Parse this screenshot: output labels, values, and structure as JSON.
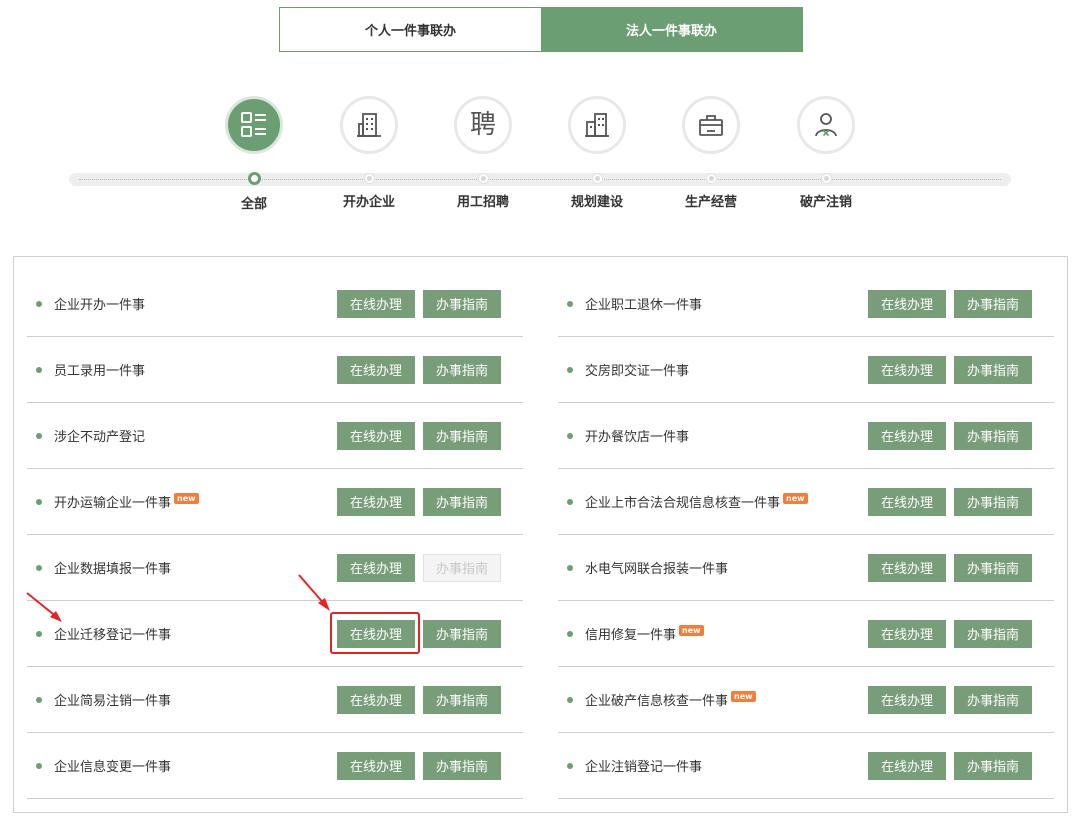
{
  "tabs": [
    {
      "label": "个人一件事联办",
      "active": false
    },
    {
      "label": "法人一件事联办",
      "active": true
    }
  ],
  "categories": [
    {
      "label": "全部",
      "icon": "grid-list-icon",
      "active": true
    },
    {
      "label": "开办企业",
      "icon": "building-icon",
      "active": false
    },
    {
      "label": "用工招聘",
      "icon": "hire-char-icon",
      "glyph": "聘",
      "active": false
    },
    {
      "label": "规划建设",
      "icon": "buildings-icon",
      "active": false
    },
    {
      "label": "生产经营",
      "icon": "briefcase-icon",
      "active": false
    },
    {
      "label": "破产注销",
      "icon": "person-cancel-icon",
      "active": false
    }
  ],
  "buttons": {
    "online": "在线办理",
    "guide": "办事指南"
  },
  "badge_text": "new",
  "left_items": [
    {
      "title": "企业开办一件事",
      "new": false,
      "guide_disabled": false
    },
    {
      "title": "员工录用一件事",
      "new": false,
      "guide_disabled": false
    },
    {
      "title": "涉企不动产登记",
      "new": false,
      "guide_disabled": false
    },
    {
      "title": "开办运输企业一件事",
      "new": true,
      "guide_disabled": false
    },
    {
      "title": "企业数据填报一件事",
      "new": false,
      "guide_disabled": true
    },
    {
      "title": "企业迁移登记一件事",
      "new": false,
      "guide_disabled": false
    },
    {
      "title": "企业简易注销一件事",
      "new": false,
      "guide_disabled": false
    },
    {
      "title": "企业信息变更一件事",
      "new": false,
      "guide_disabled": false
    }
  ],
  "right_items": [
    {
      "title": "企业职工退休一件事",
      "new": false,
      "guide_disabled": false
    },
    {
      "title": "交房即交证一件事",
      "new": false,
      "guide_disabled": false
    },
    {
      "title": "开办餐饮店一件事",
      "new": false,
      "guide_disabled": false
    },
    {
      "title": "企业上市合法合规信息核查一件事",
      "new": true,
      "guide_disabled": false
    },
    {
      "title": "水电气网联合报装一件事",
      "new": false,
      "guide_disabled": false
    },
    {
      "title": "信用修复一件事",
      "new": true,
      "guide_disabled": false
    },
    {
      "title": "企业破产信息核查一件事",
      "new": true,
      "guide_disabled": false
    },
    {
      "title": "企业注销登记一件事",
      "new": false,
      "guide_disabled": false
    }
  ],
  "colors": {
    "accent": "#6b9e72",
    "button": "#789e79",
    "badge": "#ef7f3a",
    "annotation": "#e42424"
  }
}
